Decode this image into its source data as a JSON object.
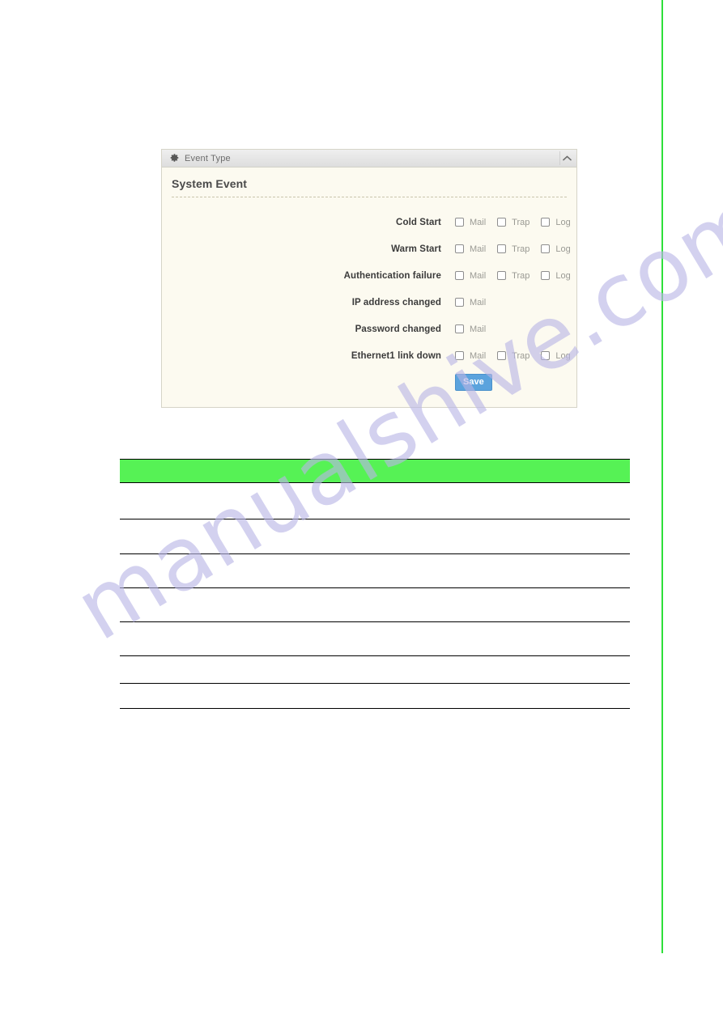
{
  "page": {
    "background_color": "#ffffff",
    "accent_green": "#2ee03a",
    "table_header_green": "#56f255",
    "panel_body_color": "#fcfaf0",
    "save_button_color": "#5ba3dd",
    "watermark_text": "manualshive.com",
    "watermark_color": "#b9b6e6"
  },
  "panel": {
    "title": "Event Type",
    "gear_icon": "gear-icon",
    "collapse_icon": "chevron-up-icon",
    "section_title": "System Event",
    "rows": [
      {
        "label": "Cold Start",
        "options": [
          {
            "label": "Mail",
            "checked": false
          },
          {
            "label": "Trap",
            "checked": false
          },
          {
            "label": "Log",
            "checked": false
          }
        ]
      },
      {
        "label": "Warm Start",
        "options": [
          {
            "label": "Mail",
            "checked": false
          },
          {
            "label": "Trap",
            "checked": false
          },
          {
            "label": "Log",
            "checked": false
          }
        ]
      },
      {
        "label": "Authentication failure",
        "options": [
          {
            "label": "Mail",
            "checked": false
          },
          {
            "label": "Trap",
            "checked": false
          },
          {
            "label": "Log",
            "checked": false
          }
        ]
      },
      {
        "label": "IP address changed",
        "options": [
          {
            "label": "Mail",
            "checked": false
          }
        ]
      },
      {
        "label": "Password changed",
        "options": [
          {
            "label": "Mail",
            "checked": false
          }
        ]
      },
      {
        "label": "Ethernet1 link down",
        "options": [
          {
            "label": "Mail",
            "checked": false
          },
          {
            "label": "Trap",
            "checked": false
          },
          {
            "label": "Log",
            "checked": false
          }
        ]
      }
    ],
    "save_label": "Save"
  },
  "spec_table": {
    "header": [
      "",
      ""
    ],
    "rows": [
      [
        "",
        ""
      ],
      [
        "",
        ""
      ],
      [
        "",
        ""
      ],
      [
        "",
        ""
      ],
      [
        "",
        ""
      ],
      [
        "",
        ""
      ],
      [
        "",
        ""
      ]
    ]
  }
}
